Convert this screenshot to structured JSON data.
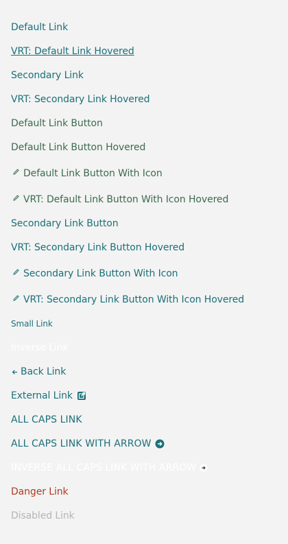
{
  "links": {
    "default": "Default Link",
    "default_hovered": "VRT: Default Link Hovered",
    "secondary": "Secondary Link",
    "secondary_hovered": "VRT: Secondary Link Hovered",
    "default_button": "Default Link Button",
    "default_button_hovered": "Default Link Button Hovered",
    "default_button_icon": "Default Link Button With Icon",
    "default_button_icon_hovered": "VRT: Default Link Button With Icon Hovered",
    "secondary_button": "Secondary Link Button",
    "secondary_button_hovered": "VRT: Secondary Link Button Hovered",
    "secondary_button_icon": "Secondary Link Button With Icon",
    "secondary_button_icon_hovered": "VRT: Secondary Link Button With Icon Hovered",
    "small": "Small Link",
    "inverse": "Inverse Link",
    "back": "Back Link",
    "external": "External Link",
    "all_caps": "ALL CAPS LINK",
    "all_caps_arrow": "ALL CAPS LINK WITH ARROW",
    "inverse_all_caps_arrow": "INVERSE ALL CAPS LINK WITH ARROW",
    "danger": "Danger Link",
    "disabled": "Disabled Link"
  },
  "colors": {
    "background": "#f3f3f3",
    "teal_link": "#1b7079",
    "green_link": "#3d6b4f",
    "danger": "#b03a24",
    "disabled": "#b5b5b5",
    "inverse": "#ffffff"
  },
  "icons": {
    "edit": "pencil-icon",
    "back": "arrow-left-icon",
    "external": "external-link-icon",
    "arrow_circle": "arrow-right-circle-icon",
    "arrow": "arrow-right-icon"
  }
}
